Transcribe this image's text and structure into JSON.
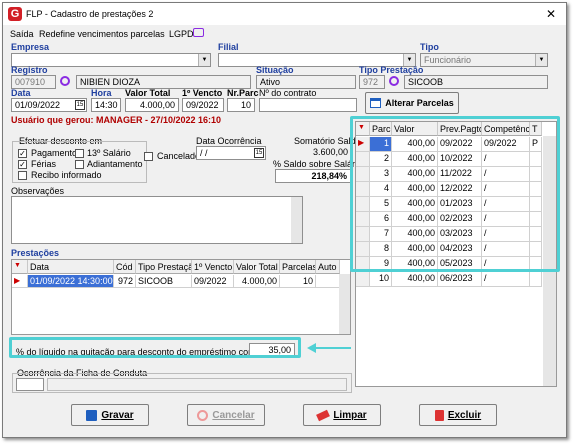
{
  "window": {
    "title": "FLP - Cadastro de prestações 2",
    "close": "✕"
  },
  "menu": [
    "Saída",
    "Redefine vencimentos parcelas",
    "LGPD"
  ],
  "labels": {
    "empresa": "Empresa",
    "filial": "Filial",
    "tipo": "Tipo",
    "registro": "Registro",
    "situacao": "Situação",
    "tipo_prestacao": "Tipo Prestação",
    "data": "Data",
    "hora": "Hora",
    "valor_total": "Valor Total",
    "primeiro_vencto": "1º Vencto",
    "nr_parc": "Nr.Parc",
    "nr_contrato": "Nº do contrato",
    "efetuar_desconto": "Efetuar desconto em",
    "data_ocorrencia": "Data Ocorrência",
    "somatorio_saldo": "Somatório Saldo",
    "saldo_sobre_salario": "% Saldo sobre Salário",
    "observacoes": "Observações",
    "prestacoes": "Prestações",
    "pct_liquido": "% do líquido na quitação para desconto do empréstimo consignado",
    "ocorrencia_ficha": "Ocorrência da Ficha de Conduta"
  },
  "fields": {
    "empresa": "",
    "filial": "",
    "tipo": "Funcionário",
    "registro": "007910",
    "nome": "NIBIEN DIOZA",
    "situacao": "Ativo",
    "tipo_prest_cod": "972",
    "tipo_prest_nome": "SICOOB",
    "data": "01/09/2022",
    "hora": "14:30",
    "valor_total": "4.000,00",
    "primeiro_vencto": "09/2022",
    "nr_parc": "10",
    "nr_contrato": "",
    "data_ocorrencia": "/ /",
    "somatorio_saldo": "3.600,00",
    "saldo_sobre_salario": "218,84%",
    "pct_liquido": "35,00"
  },
  "user_info": "Usuário que gerou: MANAGER - 27/10/2022 16:10",
  "checkboxes": {
    "pagamento": {
      "label": "Pagamento",
      "checked": true
    },
    "ferias": {
      "label": "Férias",
      "checked": true
    },
    "recibo": {
      "label": "Recibo informado",
      "checked": false
    },
    "decimo": {
      "label": "13º Salário",
      "checked": false
    },
    "adiantamento": {
      "label": "Adiantamento",
      "checked": false
    },
    "cancelado": {
      "label": "Cancelado",
      "checked": false
    }
  },
  "alterar_parcelas": "Alterar Parcelas",
  "parcelas": {
    "headers": [
      "Parc",
      "Valor",
      "Prev.Pagto",
      "Competência",
      "T"
    ],
    "rows": [
      [
        "1",
        "400,00",
        "09/2022",
        "09/2022",
        "P"
      ],
      [
        "2",
        "400,00",
        "10/2022",
        "/",
        ""
      ],
      [
        "3",
        "400,00",
        "11/2022",
        "/",
        ""
      ],
      [
        "4",
        "400,00",
        "12/2022",
        "/",
        ""
      ],
      [
        "5",
        "400,00",
        "01/2023",
        "/",
        ""
      ],
      [
        "6",
        "400,00",
        "02/2023",
        "/",
        ""
      ],
      [
        "7",
        "400,00",
        "03/2023",
        "/",
        ""
      ],
      [
        "8",
        "400,00",
        "04/2023",
        "/",
        ""
      ],
      [
        "9",
        "400,00",
        "05/2023",
        "/",
        ""
      ],
      [
        "10",
        "400,00",
        "06/2023",
        "/",
        ""
      ]
    ]
  },
  "prestacoes": {
    "headers": [
      "Data",
      "Cód",
      "Tipo Prestação",
      "1º Vencto",
      "Valor Total",
      "Parcelas",
      "Auto c"
    ],
    "rows": [
      [
        "01/09/2022 14:30:00",
        "972",
        "SICOOB",
        "09/2022",
        "4.000,00",
        "10",
        ""
      ]
    ]
  },
  "buttons": {
    "gravar": "Gravar",
    "cancelar": "Cancelar",
    "limpar": "Limpar",
    "excluir": "Excluir"
  },
  "colors": {
    "accent": "#1f3f9f",
    "highlight": "#4fd0d4",
    "selected_row": "#3b6fd6",
    "logo": "#d21f26",
    "red_text": "#b00000"
  }
}
